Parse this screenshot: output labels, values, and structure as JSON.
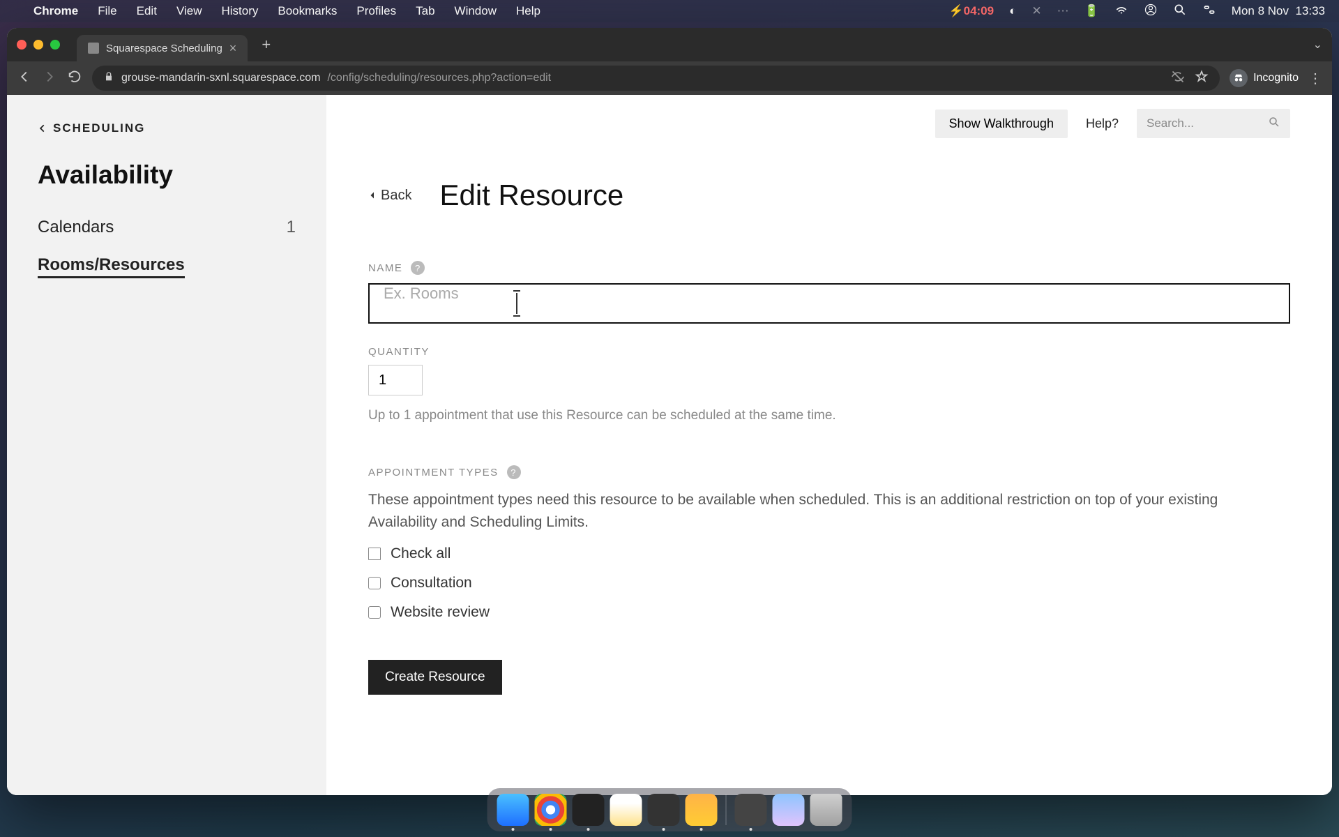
{
  "menubar": {
    "app": "Chrome",
    "items": [
      "File",
      "Edit",
      "View",
      "History",
      "Bookmarks",
      "Profiles",
      "Tab",
      "Window",
      "Help"
    ],
    "timer": "04:09",
    "date": "Mon 8 Nov",
    "time": "13:33"
  },
  "browser": {
    "tab_title": "Squarespace Scheduling",
    "url_host": "grouse-mandarin-sxnl.squarespace.com",
    "url_path": "/config/scheduling/resources.php?action=edit",
    "incognito": "Incognito"
  },
  "sidebar": {
    "crumb": "SCHEDULING",
    "title": "Availability",
    "items": [
      {
        "label": "Calendars",
        "count": "1",
        "active": false
      },
      {
        "label": "Rooms/Resources",
        "count": "",
        "active": true
      }
    ]
  },
  "topbar": {
    "walkthrough": "Show Walkthrough",
    "help": "Help?",
    "search_placeholder": "Search..."
  },
  "header": {
    "back": "Back",
    "title": "Edit Resource"
  },
  "form": {
    "name_label": "NAME",
    "name_placeholder": "Ex. Rooms",
    "name_value": "",
    "qty_label": "QUANTITY",
    "qty_value": "1",
    "qty_hint": "Up to 1 appointment that use this Resource can be scheduled at the same time.",
    "apt_label": "APPOINTMENT TYPES",
    "apt_desc": "These appointment types need this resource to be available when scheduled. This is an additional restriction on top of your existing Availability and Scheduling Limits.",
    "check_all": "Check all",
    "types": [
      "Consultation",
      "Website review"
    ],
    "submit": "Create Resource"
  }
}
